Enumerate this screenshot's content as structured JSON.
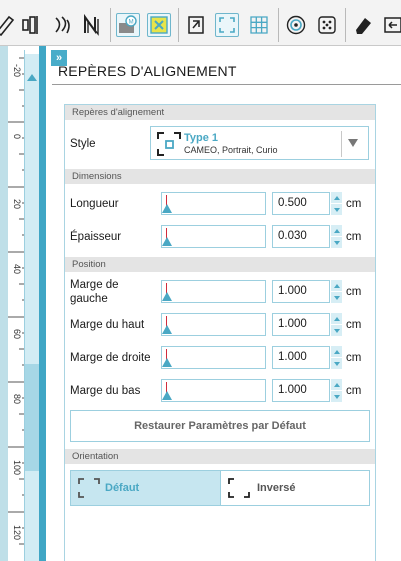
{
  "toolbar": {
    "icons": [
      "draw-icon",
      "align-icon",
      "replicate-icon",
      "nesting-icon",
      "registration-marks-icon",
      "page-setup-icon",
      "send-icon",
      "trace-icon",
      "grid-icon",
      "offset-icon",
      "knife-icon",
      "eraser-icon",
      "send-panel-icon"
    ]
  },
  "ruler": {
    "labels": [
      "-20",
      "0",
      "20",
      "40",
      "60",
      "80",
      "100",
      "120"
    ]
  },
  "panel": {
    "collapse_glyph": "»",
    "title": "REPÈRES D'ALIGNEMENT",
    "sections": {
      "marks": "Repères d'alignement",
      "dimensions": "Dimensions",
      "position": "Position",
      "orientation": "Orientation"
    },
    "style": {
      "label": "Style",
      "name": "Type 1",
      "subtitle": "CAMEO, Portrait, Curio"
    },
    "dimensions": [
      {
        "label": "Longueur",
        "value": "0.500",
        "unit": "cm",
        "level": 0.0
      },
      {
        "label": "Épaisseur",
        "value": "0.030",
        "unit": "cm",
        "level": 0.0
      }
    ],
    "position": [
      {
        "label": "Marge de gauche",
        "value": "1.000",
        "unit": "cm",
        "level": 0.0
      },
      {
        "label": "Marge du haut",
        "value": "1.000",
        "unit": "cm",
        "level": 0.0
      },
      {
        "label": "Marge de droite",
        "value": "1.000",
        "unit": "cm",
        "level": 0.0
      },
      {
        "label": "Marge du bas",
        "value": "1.000",
        "unit": "cm",
        "level": 0.0
      }
    ],
    "reset_button": "Restaurer Paramètres par Défaut",
    "orientation": {
      "default_label": "Défaut",
      "inverse_label": "Inversé",
      "selected": "default"
    }
  },
  "colors": {
    "accent": "#4aa8c4",
    "accent_light": "#c6e6f0",
    "marker_red": "#d02c3c"
  }
}
